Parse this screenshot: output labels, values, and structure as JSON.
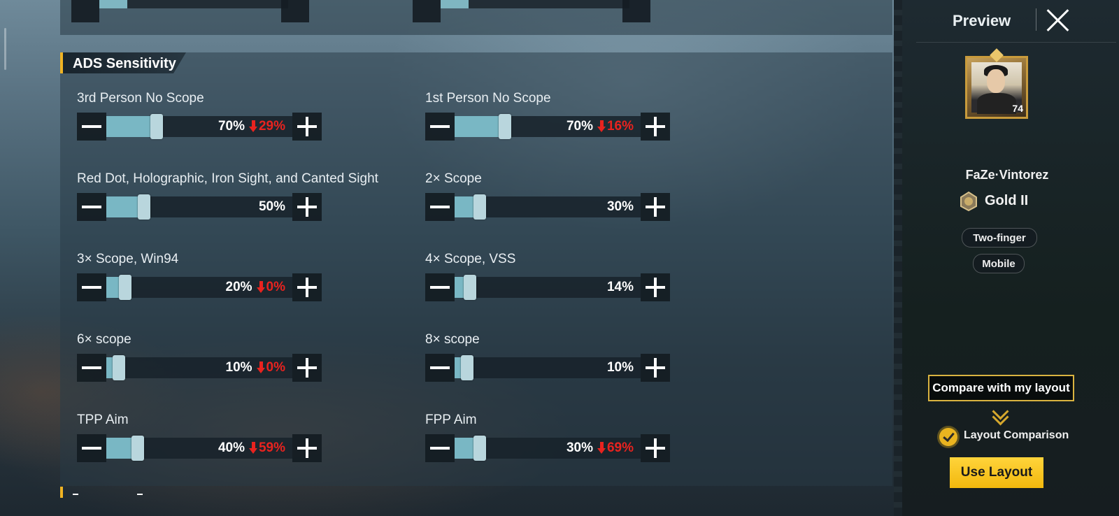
{
  "section": {
    "title": "ADS Sensitivity"
  },
  "settings": [
    {
      "label": "3rd Person No Scope",
      "value": "70%",
      "delta": "29%",
      "fraction": 0.7
    },
    {
      "label": "1st Person No Scope",
      "value": "70%",
      "delta": "16%",
      "fraction": 0.7
    },
    {
      "label": "Red Dot, Holographic, Iron Sight, and Canted Sight",
      "value": "50%",
      "delta": "",
      "fraction": 0.5
    },
    {
      "label": "2× Scope",
      "value": "30%",
      "delta": "",
      "fraction": 0.3
    },
    {
      "label": "3× Scope, Win94",
      "value": "20%",
      "delta": "0%",
      "fraction": 0.2
    },
    {
      "label": "4× Scope, VSS",
      "value": "14%",
      "delta": "",
      "fraction": 0.14
    },
    {
      "label": "6× scope",
      "value": "10%",
      "delta": "0%",
      "fraction": 0.1
    },
    {
      "label": "8× scope",
      "value": "10%",
      "delta": "",
      "fraction": 0.1
    },
    {
      "label": "TPP Aim",
      "value": "40%",
      "delta": "59%",
      "fraction": 0.4
    },
    {
      "label": "FPP Aim",
      "value": "30%",
      "delta": "69%",
      "fraction": 0.3
    }
  ],
  "sidebar": {
    "title": "Preview",
    "player_name": "FaZe·Vintorez",
    "avatar_level": "74",
    "rank": "Gold II",
    "control_mode": "Two-finger",
    "device": "Mobile",
    "compare_label": "Compare with my layout",
    "layout_comparison_label": "Layout Comparison",
    "use_layout_label": "Use Layout"
  },
  "colors": {
    "accent_gold": "#f0b323",
    "slider_fill": "#79b7c4",
    "decrease_red": "#e8231f",
    "use_button": "#f2b80d"
  }
}
